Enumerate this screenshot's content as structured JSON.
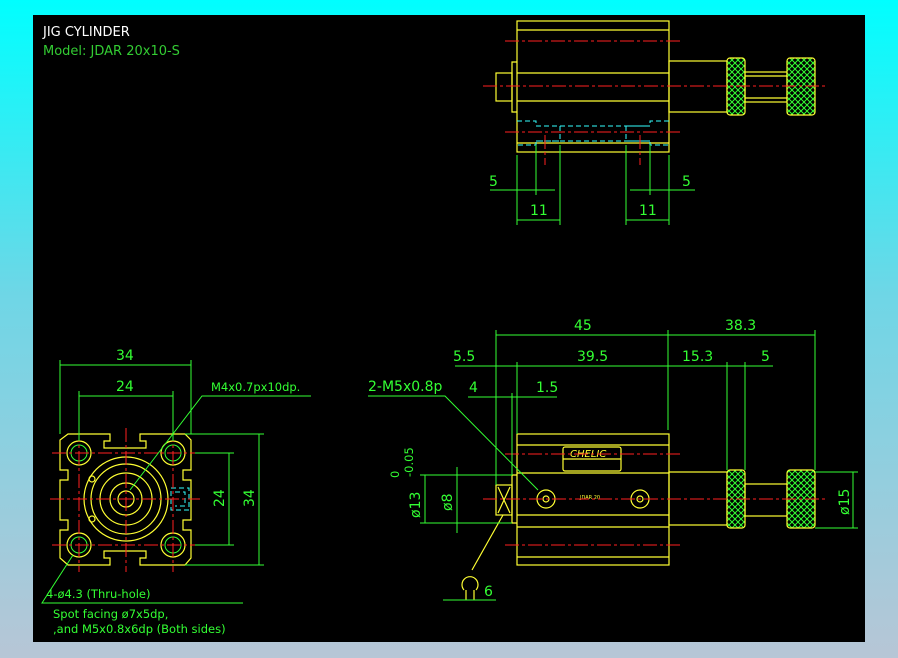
{
  "title": "JIG CYLINDER",
  "model": "Model:  JDAR 20x10-S",
  "colors": {
    "background": "#000000",
    "outline": "#ffff33",
    "dimension": "#33ff33",
    "centerline": "#ff2020",
    "hidden": "#33ffff",
    "frame": "#00ffff"
  },
  "top_view": {
    "dims": {
      "left_5": "5",
      "right_5": "5",
      "left_11": "11",
      "right_11": "11"
    }
  },
  "front_view": {
    "dims": {
      "width_outer": "34",
      "width_pitch": "24",
      "height_pitch": "24",
      "height_outer": "34"
    },
    "callouts": {
      "tap": "M4x0.7px10dp.",
      "holes": "4-ø4.3 (Thru-hole)",
      "spot1": "Spot facing ø7x5dp,",
      "spot2": ",and M5x0.8x6dp (Both sides)"
    }
  },
  "side_view": {
    "dims": {
      "d45": "45",
      "d38_3": "38.3",
      "d5_5": "5.5",
      "d39_5": "39.5",
      "d15_3": "15.3",
      "d5": "5",
      "d4": "4",
      "d1_5": "1.5",
      "d6": "6",
      "dia13": "ø13",
      "tol_upper": "0",
      "tol_lower": "-0.05",
      "dia8": "ø8",
      "dia15": "ø15"
    },
    "callouts": {
      "ports": "2-M5x0.8p"
    },
    "label": {
      "brand": "CHELIC",
      "engraving": "JDAR 20"
    }
  }
}
